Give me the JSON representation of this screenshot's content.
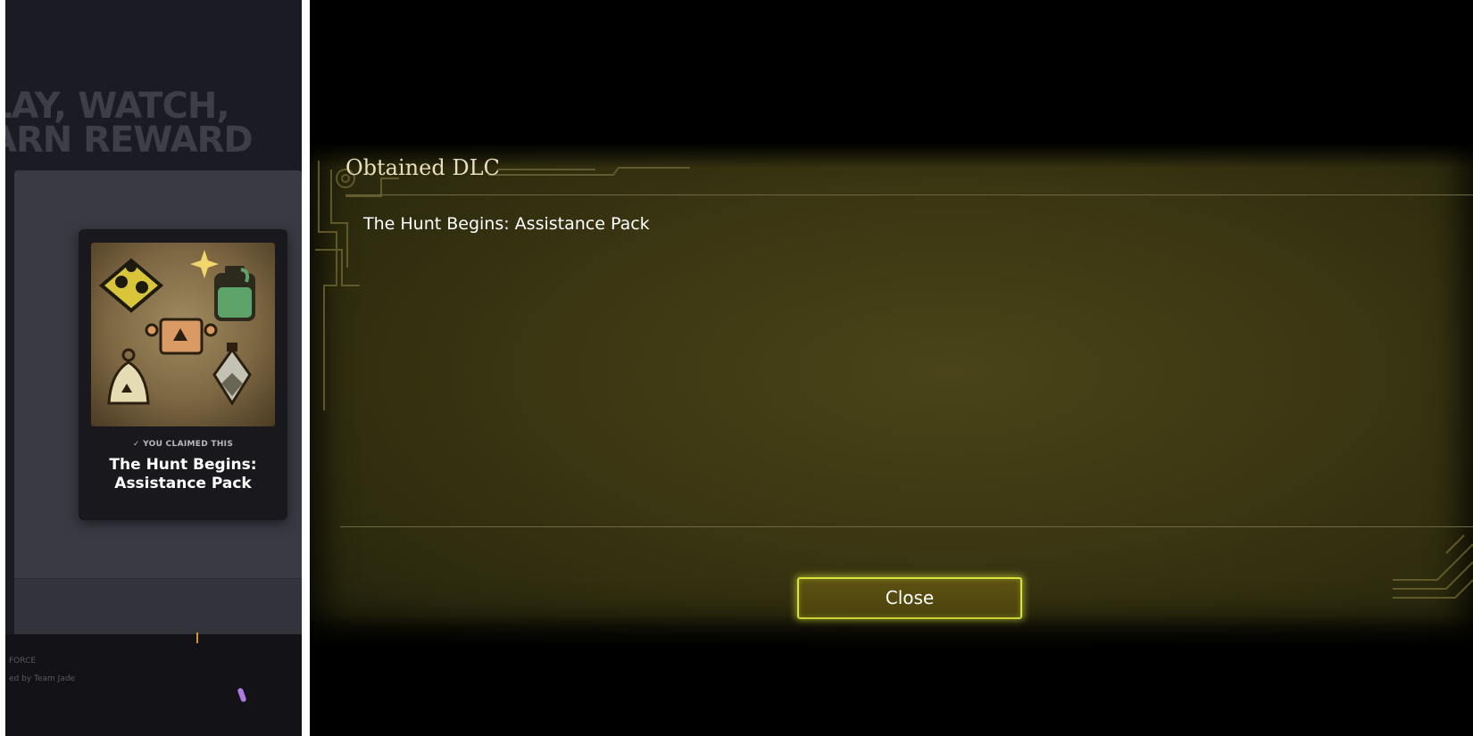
{
  "left_panel": {
    "background_text": [
      "LAY, WATCH,",
      "ARN REWARD"
    ],
    "card": {
      "claimed_label": "YOU CLAIMED THIS",
      "title_line1": "The Hunt Begins:",
      "title_line2": "Assistance Pack"
    },
    "bottom_text_1": "FORCE",
    "bottom_text_2": "ed by Team Jade"
  },
  "right_panel": {
    "heading": "Obtained DLC",
    "items": [
      "The Hunt Begins: Assistance Pack"
    ],
    "close_label": "Close"
  },
  "colors": {
    "accent_glow": "#d9e43a",
    "panel_olive": "#3b3612",
    "heading_cream": "#e9dfbd"
  }
}
